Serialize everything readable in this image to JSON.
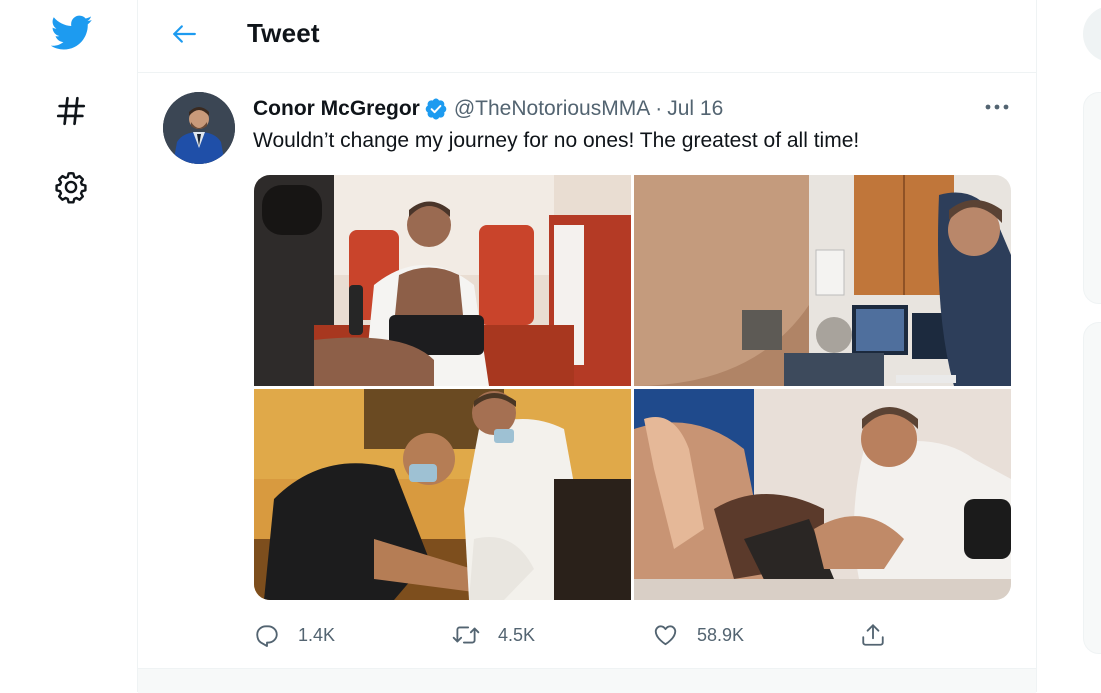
{
  "header": {
    "title": "Tweet"
  },
  "tweet": {
    "display_name": "Conor McGregor",
    "handle": "@TheNotoriousMMA",
    "separator": "·",
    "date": "Jul 16",
    "text": "Wouldn’t change my journey for no ones! The greatest of all time!",
    "replies": "1.4K",
    "retweets": "4.5K",
    "likes": "58.9K"
  },
  "icons": {
    "logo": "twitter-bird-icon",
    "explore": "hashtag-icon",
    "settings": "gear-icon",
    "back": "arrow-left-icon",
    "verified": "verified-badge-icon",
    "more": "more-dots-icon",
    "reply": "reply-icon",
    "retweet": "retweet-icon",
    "like": "heart-icon",
    "share": "share-icon"
  },
  "colors": {
    "brand": "#1d9bf0",
    "text": "#0f1419",
    "secondary": "#536471",
    "border": "#eff3f4"
  }
}
